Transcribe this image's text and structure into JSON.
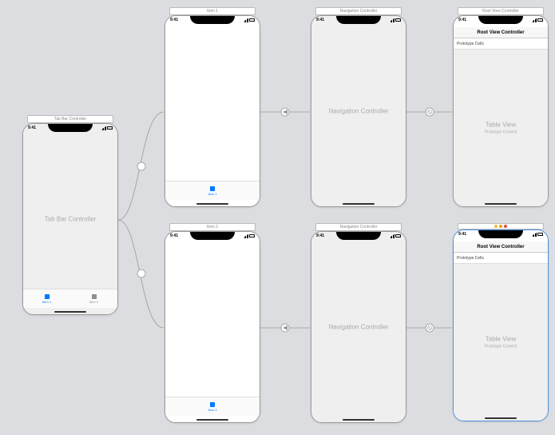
{
  "status_time": "9:41",
  "scenes": {
    "tabbar_controller": {
      "title": "Tab Bar Controller",
      "center": "Tab Bar Controller",
      "tabs": [
        {
          "label": "Item 1",
          "active": true
        },
        {
          "label": "Item 2",
          "active": false
        }
      ]
    },
    "item1": {
      "title": "Item 1",
      "tab_label": "Item 1"
    },
    "item2": {
      "title": "Item 2",
      "tab_label": "Item 2"
    },
    "nav1": {
      "title": "Navigation Controller",
      "center": "Navigation Controller"
    },
    "nav2": {
      "title": "Navigation Controller",
      "center": "Navigation Controller"
    },
    "root1": {
      "title": "Root View Controller",
      "nav_title": "Root View Controller",
      "proto": "Prototype Cells",
      "center_main": "Table View",
      "center_sub": "Prototype Content"
    },
    "root2": {
      "title": "Root View Controller",
      "nav_title": "Root View Controller",
      "proto": "Prototype Cells",
      "center_main": "Table View",
      "center_sub": "Prototype Content"
    }
  }
}
